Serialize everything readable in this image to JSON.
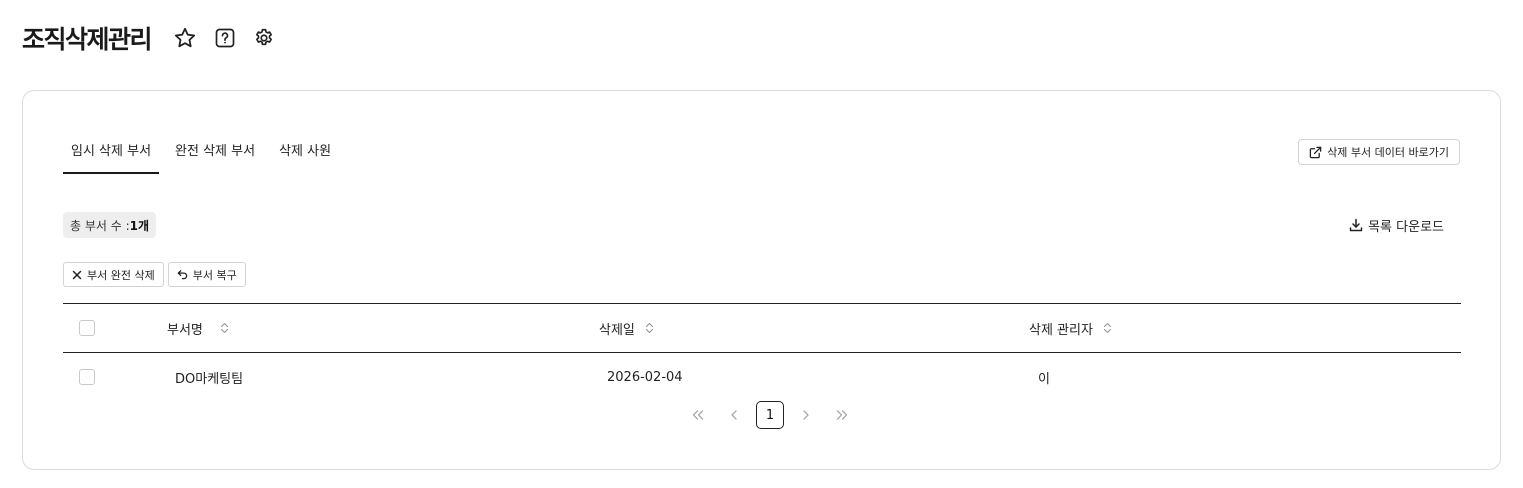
{
  "page": {
    "title": "조직삭제관리",
    "icons": [
      "star-icon",
      "help-icon",
      "gear-icon"
    ]
  },
  "tabs": [
    {
      "label": "임시 삭제 부서",
      "active": true
    },
    {
      "label": "완전 삭제 부서",
      "active": false
    },
    {
      "label": "삭제 사원",
      "active": false
    }
  ],
  "link_button": {
    "label": "삭제 부서 데이터 바로가기",
    "icon": "external-link-icon"
  },
  "summary": {
    "label": "총 부서 수 : ",
    "count": "1개"
  },
  "download": {
    "label": "목록 다운로드",
    "icon": "download-icon"
  },
  "actions": [
    {
      "label": "부서 완전 삭제",
      "icon": "close-icon"
    },
    {
      "label": "부서 복구",
      "icon": "undo-icon"
    }
  ],
  "table": {
    "columns": [
      "부서명",
      "삭제일",
      "삭제 관리자"
    ],
    "rows": [
      {
        "name": "DO마케팅팀",
        "deleted_date": "2026-02-04",
        "admin": "이"
      }
    ]
  },
  "pagination": {
    "current": "1"
  },
  "colors": {
    "border": "#dcdcdc",
    "text": "#222222",
    "badge_bg": "#eeeeee"
  }
}
